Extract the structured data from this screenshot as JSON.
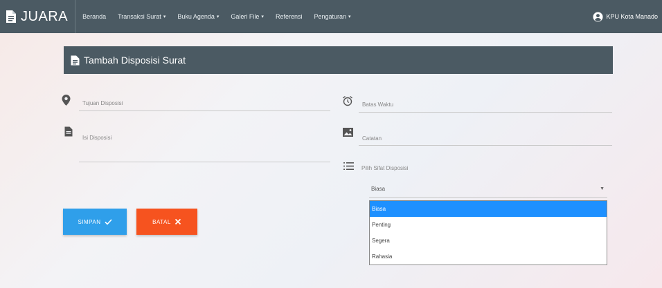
{
  "app": {
    "brand": "JUARA"
  },
  "nav": {
    "items": [
      {
        "label": "Beranda",
        "has_caret": false
      },
      {
        "label": "Transaksi Surat",
        "has_caret": true
      },
      {
        "label": "Buku Agenda",
        "has_caret": true
      },
      {
        "label": "Galeri File",
        "has_caret": true
      },
      {
        "label": "Referensi",
        "has_caret": false
      },
      {
        "label": "Pengaturan",
        "has_caret": true
      }
    ],
    "user": "KPU Kota Manado"
  },
  "card": {
    "title": "Tambah Disposisi Surat"
  },
  "form": {
    "tujuan_label": "Tujuan Disposisi",
    "batas_label": "Batas Waktu",
    "isi_label": "Isi Disposisi",
    "catatan_label": "Catatan",
    "sifat_label": "Pilih Sifat Disposisi",
    "sifat_selected": "Biasa",
    "sifat_options": [
      "Biasa",
      "Penting",
      "Segera",
      "Rahasia"
    ]
  },
  "buttons": {
    "save": "SIMPAN",
    "cancel": "BATAL"
  },
  "colors": {
    "navbar": "#4b5a63",
    "save": "#2f9fea",
    "cancel": "#f6531f",
    "selected_option": "#1e90ff"
  },
  "icons": [
    "file-icon",
    "user-circle-icon",
    "map-marker-icon",
    "alarm-clock-icon",
    "document-icon",
    "image-icon",
    "list-icon",
    "check-icon",
    "close-icon"
  ]
}
